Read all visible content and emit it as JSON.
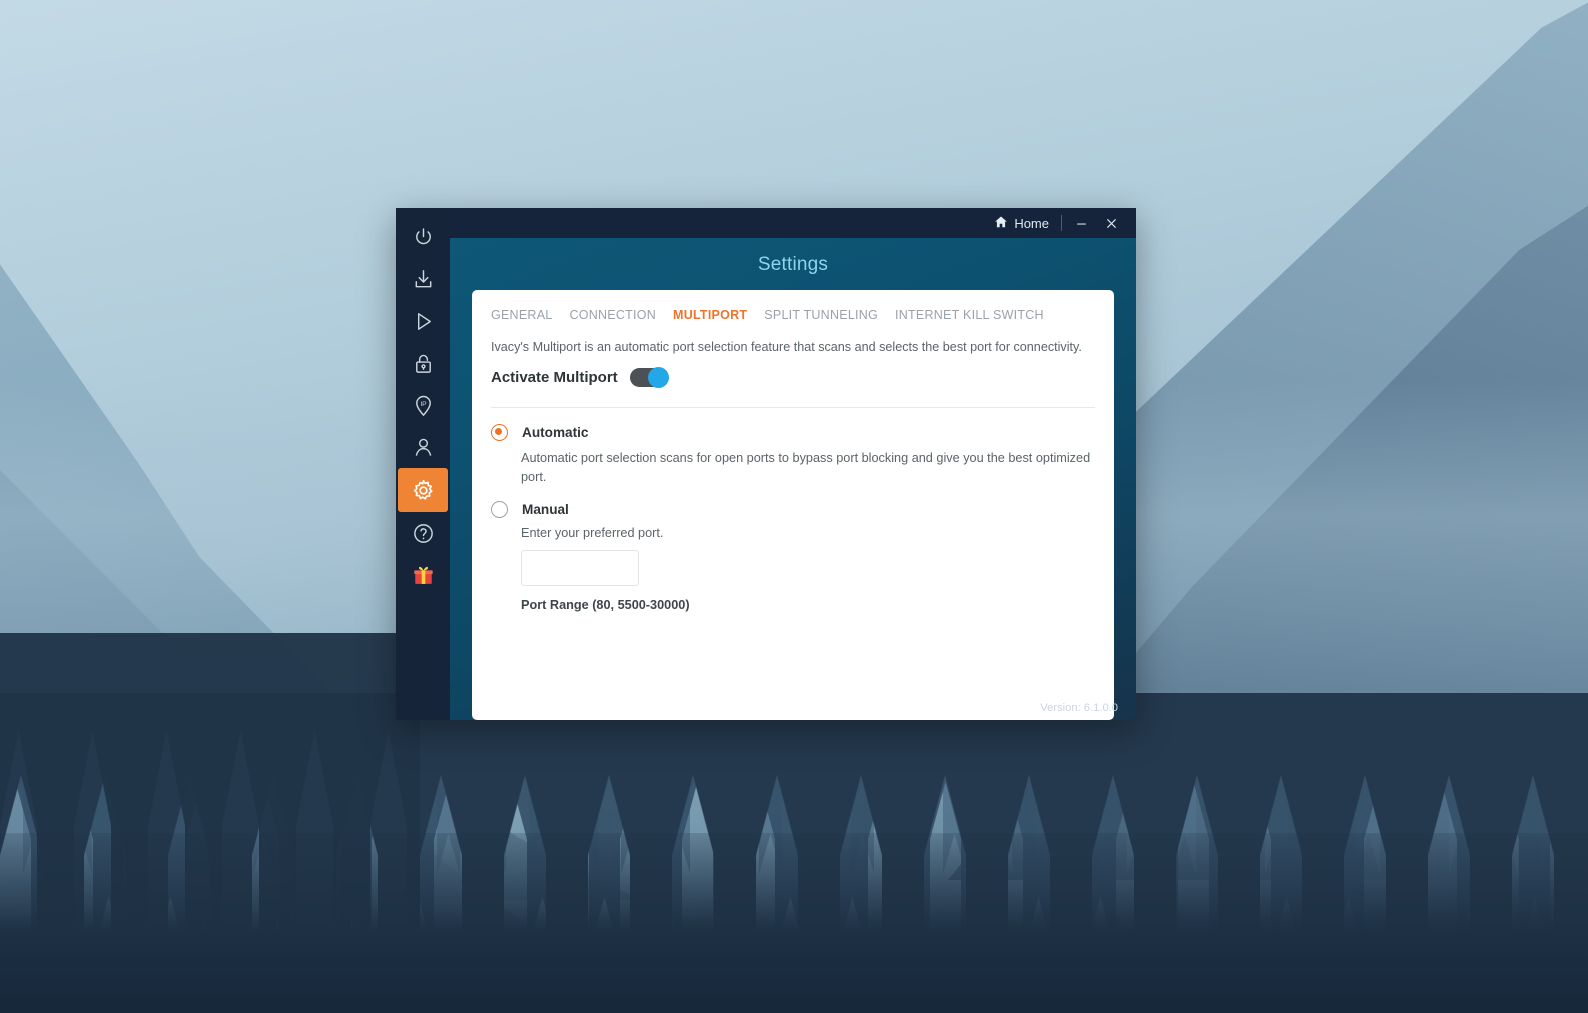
{
  "wallpaper": {
    "description": "misty blue mountain and pine forest landscape",
    "sky_color": "#b8d1de",
    "mountain_color": "#8fb2c4",
    "forest_color": "#24394e"
  },
  "window": {
    "titlebar": {
      "home_label": "Home",
      "home_icon": "home-icon",
      "minimize_label": "—",
      "close_label": "✕"
    },
    "heading": "Settings",
    "version": "Version: 6.1.0.0",
    "accent_orange": "#f0732b",
    "accent_blue": "#22a7e8",
    "titlebar_color": "#15243a",
    "body_color": "#0d5170"
  },
  "sidebar": {
    "items": [
      {
        "icon": "power-icon",
        "name": "sidebar-item-power",
        "active": false
      },
      {
        "icon": "download-icon",
        "name": "sidebar-item-download",
        "active": false
      },
      {
        "icon": "play-icon",
        "name": "sidebar-item-streaming",
        "active": false
      },
      {
        "icon": "lock-icon",
        "name": "sidebar-item-security",
        "active": false
      },
      {
        "icon": "ip-pin-icon",
        "name": "sidebar-item-ip",
        "active": false
      },
      {
        "icon": "user-icon",
        "name": "sidebar-item-account",
        "active": false
      },
      {
        "icon": "gear-icon",
        "name": "sidebar-item-settings",
        "active": true
      },
      {
        "icon": "help-icon",
        "name": "sidebar-item-help",
        "active": false
      },
      {
        "icon": "gift-icon",
        "name": "sidebar-item-gift",
        "active": false
      }
    ]
  },
  "tabs": [
    {
      "label": "GENERAL",
      "active": false
    },
    {
      "label": "CONNECTION",
      "active": false
    },
    {
      "label": "MULTIPORT",
      "active": true
    },
    {
      "label": "SPLIT TUNNELING",
      "active": false
    },
    {
      "label": "INTERNET KILL SWITCH",
      "active": false
    }
  ],
  "multiport": {
    "description": "Ivacy's Multiport  is an automatic port selection feature that scans and selects the best port for connectivity.",
    "activate_label": "Activate Multiport",
    "activate_on": true,
    "options": {
      "automatic": {
        "label": "Automatic",
        "selected": true,
        "description": "Automatic port selection scans for open ports to bypass port blocking and give you the best optimized port."
      },
      "manual": {
        "label": "Manual",
        "selected": false,
        "hint": "Enter your preferred port.",
        "port_value": "",
        "port_placeholder": "",
        "port_range": "Port Range (80, 5500-30000)"
      }
    }
  }
}
